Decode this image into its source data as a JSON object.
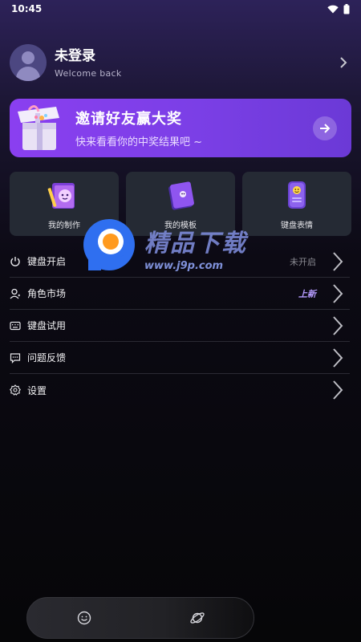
{
  "status": {
    "time": "10:45"
  },
  "profile": {
    "name": "未登录",
    "subtitle": "Welcome back"
  },
  "banner": {
    "title": "邀请好友赢大奖",
    "subtitle": "快来看看你的中奖结果吧 ~"
  },
  "grid": [
    {
      "label": "我的制作",
      "icon": "pencil-book-icon"
    },
    {
      "label": "我的模板",
      "icon": "template-book-icon"
    },
    {
      "label": "键盘表情",
      "icon": "emoji-phone-icon"
    }
  ],
  "menu": [
    {
      "label": "键盘开启",
      "value": "未开启",
      "icon": "power-icon"
    },
    {
      "label": "角色市场",
      "value": "上新",
      "icon": "user-icon"
    },
    {
      "label": "键盘试用",
      "value": "",
      "icon": "keyboard-icon"
    },
    {
      "label": "问题反馈",
      "value": "",
      "icon": "feedback-icon"
    },
    {
      "label": "设置",
      "value": "",
      "icon": "settings-icon"
    }
  ],
  "watermark": {
    "title": "精品下载",
    "url": "www.j9p.com"
  },
  "colors": {
    "accent": "#8a3ff0",
    "card": "#252a34",
    "background": "#060608"
  }
}
